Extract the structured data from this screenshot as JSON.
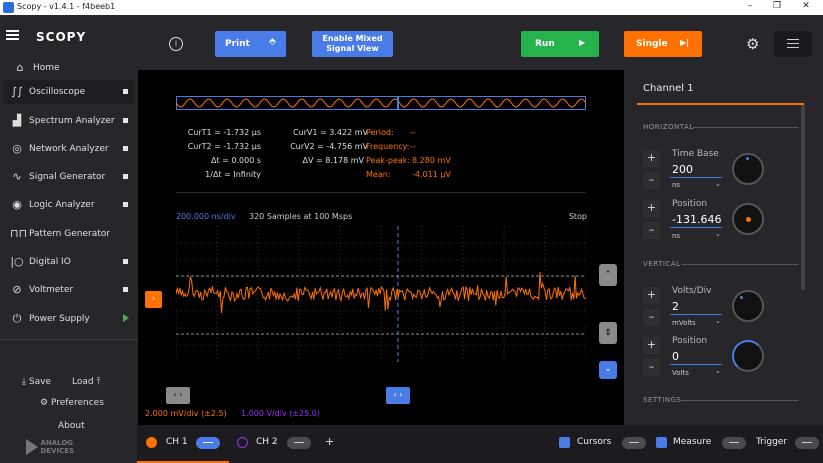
{
  "window": {
    "title": "Scopy - v1.4.1 - f4beeb1",
    "minimize": "–",
    "maximize": "❐",
    "close": "✕"
  },
  "sidebar": {
    "logo": "SCOPY",
    "home": "Home",
    "items": [
      {
        "label": "Oscilloscope",
        "active": true
      },
      {
        "label": "Spectrum Analyzer"
      },
      {
        "label": "Network Analyzer"
      },
      {
        "label": "Signal Generator"
      },
      {
        "label": "Logic Analyzer"
      },
      {
        "label": "Pattern Generator"
      },
      {
        "label": "Digital IO"
      },
      {
        "label": "Voltmeter"
      },
      {
        "label": "Power Supply"
      }
    ],
    "save": "Save",
    "load": "Load",
    "preferences": "Preferences",
    "about": "About",
    "brand_line1": "ANALOG",
    "brand_line2": "DEVICES"
  },
  "toolbar": {
    "info": "i",
    "print": "Print",
    "mixed_line1": "Enable Mixed",
    "mixed_line2": "Signal View",
    "run": "Run",
    "single": "Single"
  },
  "measure": {
    "curt1": "CurT1 = -1.732 µs",
    "curt2": "CurT2 = -1.732 µs",
    "dt": "Δt = 0.000 s",
    "invdt": "1/Δt = Infinity",
    "curv1": "CurV1 = 3.422 mV",
    "curv2": "CurV2 = -4.756 mV",
    "dv": "ΔV = 8.178 mV",
    "period_l": "Period:",
    "period_v": "--",
    "freq_l": "Frequency:",
    "freq_v": "--",
    "pp_l": "Peak-peak:",
    "pp_v": "8.280 mV",
    "mean_l": "Mean:",
    "mean_v": "-4.011 µV"
  },
  "plot": {
    "timebase": "200.000 ns/div",
    "samples": "320 Samples at 100 Msps",
    "state": "Stop",
    "ch1_scale": "2.000 mV/div (±2.5)",
    "ch2_scale": "1.000 V/div (±25.0)"
  },
  "panel": {
    "title": "Channel 1",
    "horizontal": "HORIZONTAL",
    "vertical": "VERTICAL",
    "settings": "SETTINGS",
    "timebase_label": "Time Base",
    "timebase_value": "200",
    "timebase_unit": "ns",
    "hpos_label": "Position",
    "hpos_value": "-131.646",
    "hpos_unit": "ns",
    "volts_label": "Volts/Div",
    "volts_value": "2",
    "volts_unit": "mVolts",
    "vpos_label": "Position",
    "vpos_value": "0",
    "vpos_unit": "Volts"
  },
  "bottom": {
    "ch1": "CH 1",
    "ch2": "CH 2",
    "add": "+",
    "cursors": "Cursors",
    "measure": "Measure",
    "trigger": "Trigger"
  },
  "colors": {
    "ch1": "#ff7200",
    "ch2": "#9b30ff",
    "accent": "#4a7ce8",
    "run": "#27b34b",
    "single": "#ff7200"
  }
}
